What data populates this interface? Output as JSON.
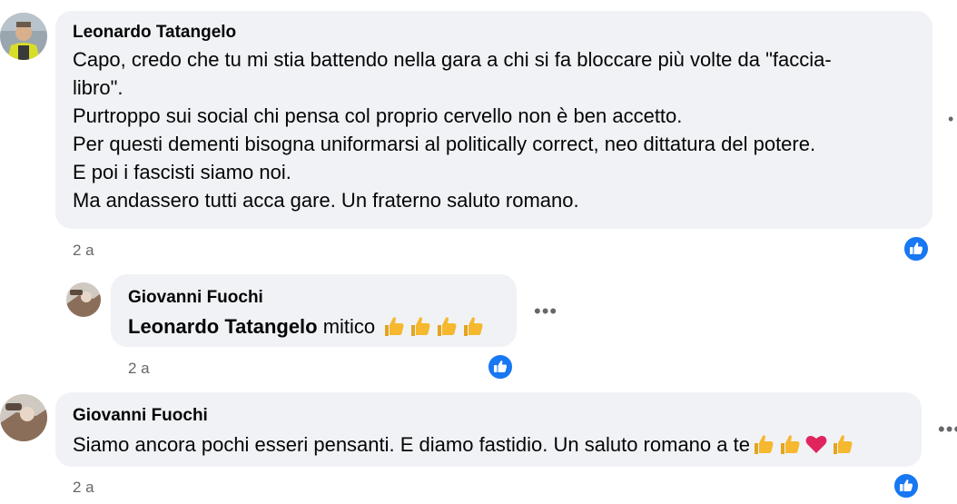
{
  "comments": [
    {
      "author": "Leonardo Tatangelo",
      "lines": [
        "Capo, credo che tu mi stia battendo nella gara a chi si fa bloccare più volte da \"faccia-",
        "libro\".",
        "Purtroppo sui social chi pensa col proprio cervello non è ben accetto.",
        "Per questi dementi bisogna uniformarsi al politically correct, neo dittatura del potere.",
        "E poi i fascisti siamo noi.",
        "Ma andassero tutti acca gare. Un fraterno saluto romano."
      ],
      "timestamp": "2 a",
      "reaction": "like-icon"
    },
    {
      "author": "Giovanni Fuochi",
      "mention": "Leonardo Tatangelo",
      "text": " mitico ",
      "emojis": [
        "thumbs-up-icon",
        "thumbs-up-icon",
        "thumbs-up-icon",
        "thumbs-up-icon"
      ],
      "timestamp": "2 a",
      "reaction": "like-icon",
      "more": "•••"
    },
    {
      "author": "Giovanni Fuochi",
      "text": "Siamo ancora pochi esseri pensanti. E diamo fastidio. Un saluto romano a te",
      "emojis": [
        "thumbs-up-icon",
        "thumbs-up-icon",
        "red-heart-icon",
        "thumbs-up-icon"
      ],
      "timestamp": "2 a",
      "reaction": "like-icon",
      "more": "•••"
    }
  ],
  "colors": {
    "bubble": "#f0f2f5",
    "text": "#050505",
    "meta": "#65676b",
    "like": "#1877f2",
    "thumb": "#f5b82e",
    "heart": "#e0245e"
  }
}
